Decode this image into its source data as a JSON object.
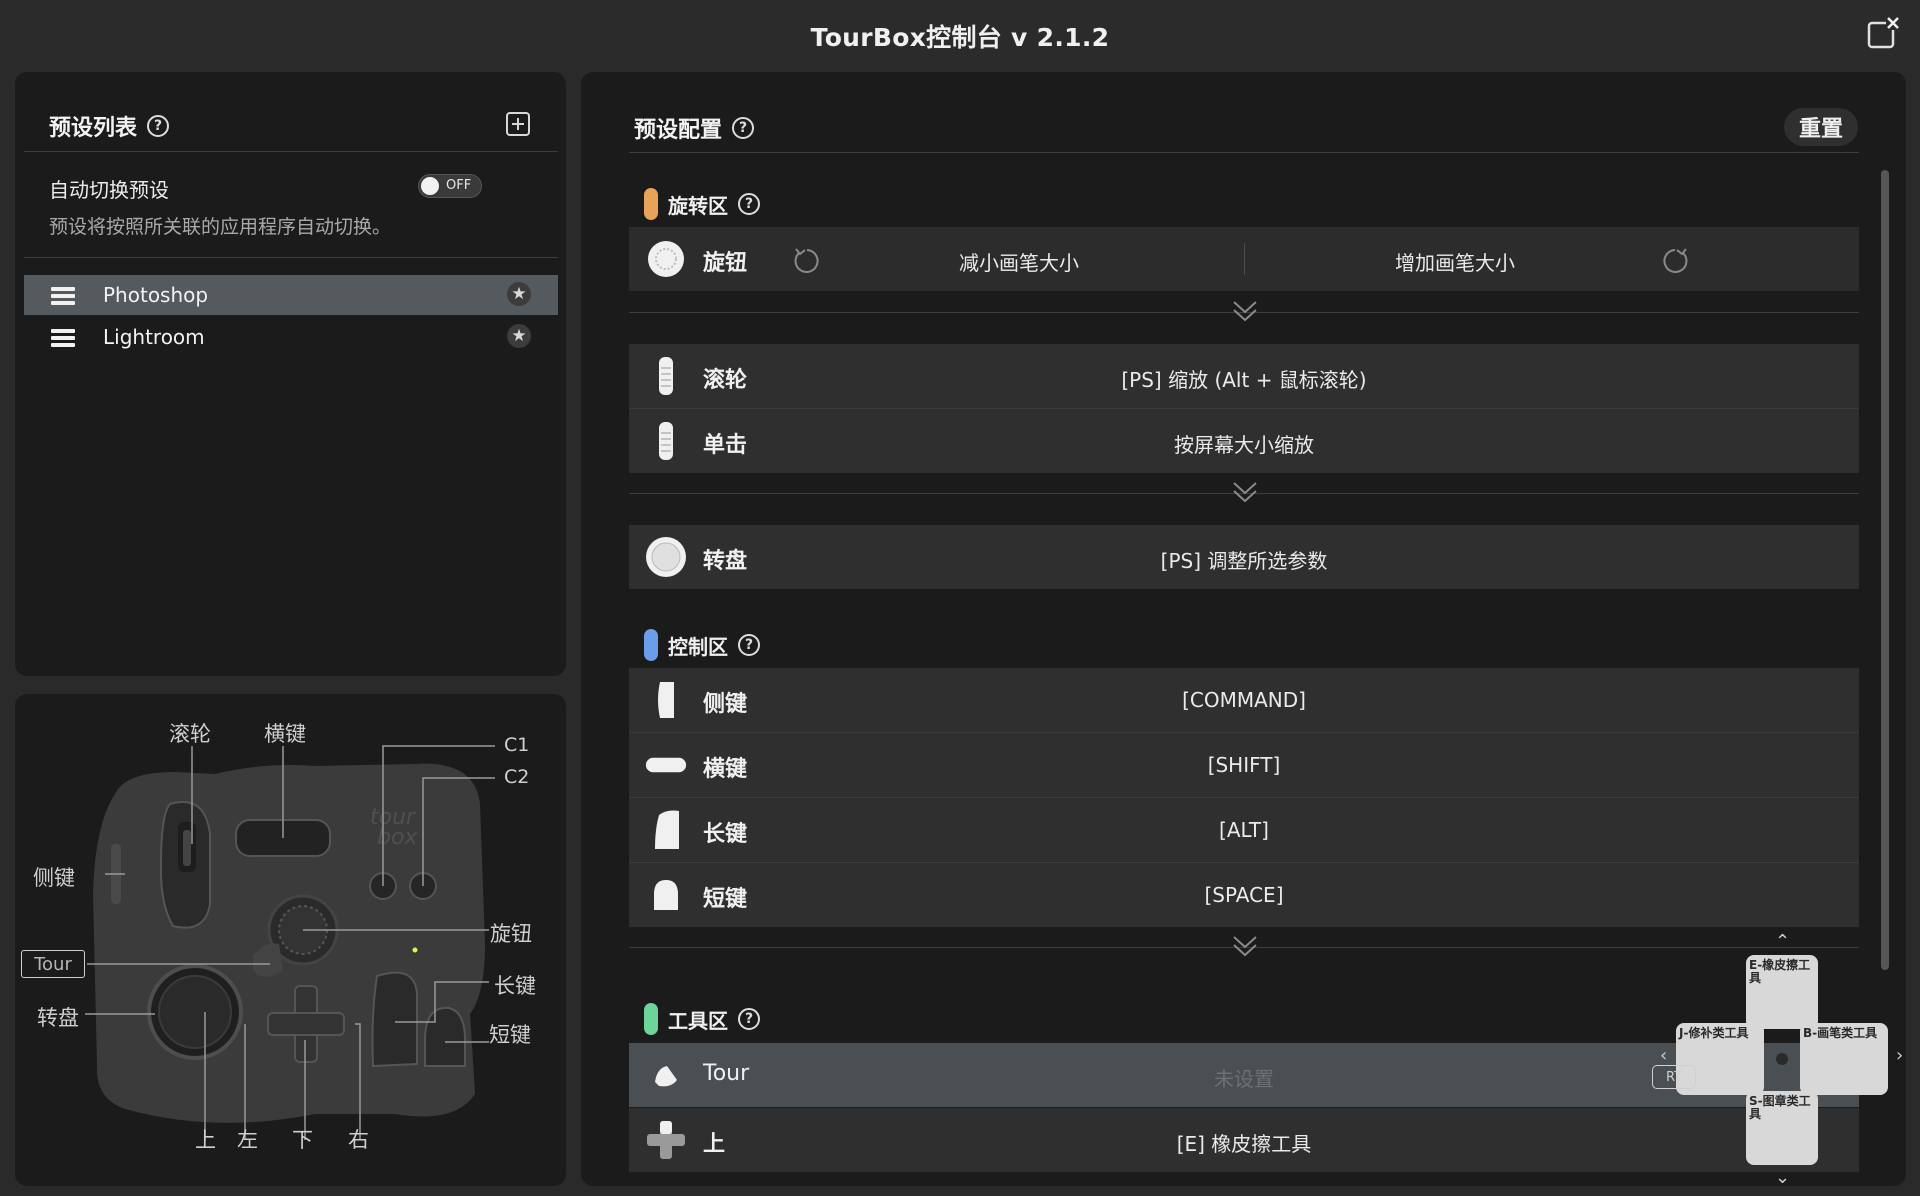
{
  "window": {
    "title": "TourBox控制台 v 2.1.2"
  },
  "preset_list": {
    "title": "预设列表",
    "auto_switch": {
      "label": "自动切换预设",
      "toggle": "OFF",
      "description": "预设将按照所关联的应用程序自动切换。"
    },
    "items": [
      {
        "name": "Photoshop",
        "active": true
      },
      {
        "name": "Lightroom",
        "active": false
      }
    ]
  },
  "device_diagram": {
    "labels": {
      "scroll": "滚轮",
      "horizontal": "横键",
      "c1": "C1",
      "c2": "C2",
      "side": "侧键",
      "knob": "旋钮",
      "tour": "Tour",
      "long": "长键",
      "dial": "转盘",
      "short": "短键",
      "up": "上",
      "left": "左",
      "down": "下",
      "right": "右"
    }
  },
  "preset_config": {
    "title": "预设配置",
    "reset_label": "重置",
    "rotation_zone": {
      "title": "旋转区",
      "color": "#e8a25a",
      "knob": {
        "label": "旋钮",
        "left_action": "减小画笔大小",
        "right_action": "增加画笔大小"
      },
      "scroll": {
        "label": "滚轮",
        "action": "[PS] 缩放 (Alt + 鼠标滚轮)"
      },
      "click": {
        "label": "单击",
        "action": "按屏幕大小缩放"
      },
      "dial": {
        "label": "转盘",
        "action": "[PS] 调整所选参数"
      }
    },
    "control_zone": {
      "title": "控制区",
      "color": "#6b9ee8",
      "rows": [
        {
          "label": "侧键",
          "action": "[COMMAND]"
        },
        {
          "label": "横键",
          "action": "[SHIFT]"
        },
        {
          "label": "长键",
          "action": "[ALT]"
        },
        {
          "label": "短键",
          "action": "[SPACE]"
        }
      ]
    },
    "tool_zone": {
      "title": "工具区",
      "color": "#6fd49a",
      "tour": {
        "label": "Tour",
        "action": "未设置"
      },
      "up": {
        "label": "上",
        "action": "[E] 橡皮擦工具"
      }
    }
  },
  "dpad_overlay": {
    "top": "E-橡皮擦工具",
    "left": "J-修补类工具",
    "right": "B-画笔类工具",
    "bottom": "S-图章类工具",
    "center_badge": "RT"
  }
}
